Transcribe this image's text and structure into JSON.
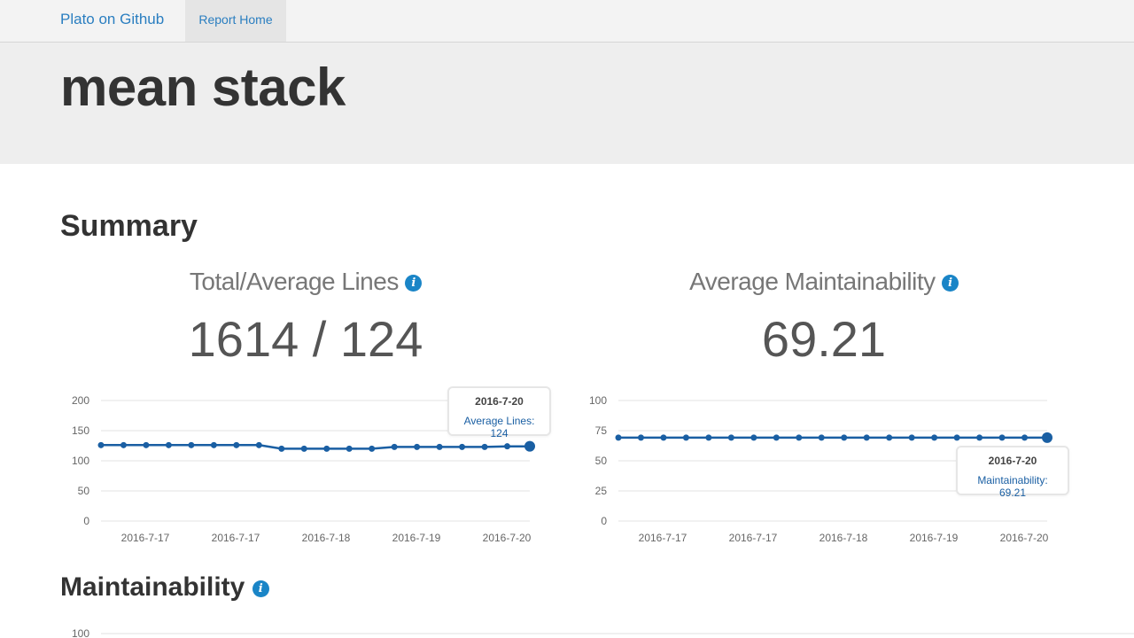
{
  "navbar": {
    "brand": "Plato on Github",
    "home": "Report Home"
  },
  "project_title": "mean stack",
  "summary": {
    "heading": "Summary",
    "lines": {
      "title": "Total/Average Lines",
      "value": "1614 / 124",
      "info_icon": "info-icon"
    },
    "maintainability": {
      "title": "Average Maintainability",
      "value": "69.21",
      "info_icon": "info-icon"
    }
  },
  "lines_tooltip": {
    "date": "2016-7-20",
    "label": "Average Lines: 124"
  },
  "maint_tooltip": {
    "date": "2016-7-20",
    "label": "Maintainability: 69.21"
  },
  "maintainability_section": {
    "heading": "Maintainability",
    "info_icon": "info-icon",
    "ytick_top": "100"
  },
  "colors": {
    "series": "#1a5fa3",
    "link": "#2a7ec0",
    "info": "#1a85c7"
  },
  "chart_data": [
    {
      "type": "line",
      "title": "Total/Average Lines",
      "yticks": [
        0,
        50,
        100,
        150,
        200
      ],
      "ylim": [
        0,
        200
      ],
      "xticks": [
        "2016-7-17",
        "2016-7-17",
        "2016-7-18",
        "2016-7-19",
        "2016-7-20"
      ],
      "series": [
        {
          "name": "Average Lines",
          "values": [
            126,
            126,
            126,
            126,
            126,
            126,
            126,
            126,
            120,
            120,
            120,
            120,
            120,
            123,
            123,
            123,
            123,
            123,
            124,
            124
          ]
        }
      ],
      "grid": true
    },
    {
      "type": "line",
      "title": "Average Maintainability",
      "yticks": [
        0,
        25,
        50,
        75,
        100
      ],
      "ylim": [
        0,
        100
      ],
      "xticks": [
        "2016-7-17",
        "2016-7-17",
        "2016-7-18",
        "2016-7-19",
        "2016-7-20"
      ],
      "series": [
        {
          "name": "Maintainability",
          "values": [
            69.2,
            69.2,
            69.2,
            69.2,
            69.2,
            69.2,
            69.2,
            69.2,
            69.2,
            69.2,
            69.2,
            69.2,
            69.2,
            69.2,
            69.2,
            69.2,
            69.2,
            69.2,
            69.2,
            69.21
          ]
        }
      ],
      "grid": true
    }
  ]
}
